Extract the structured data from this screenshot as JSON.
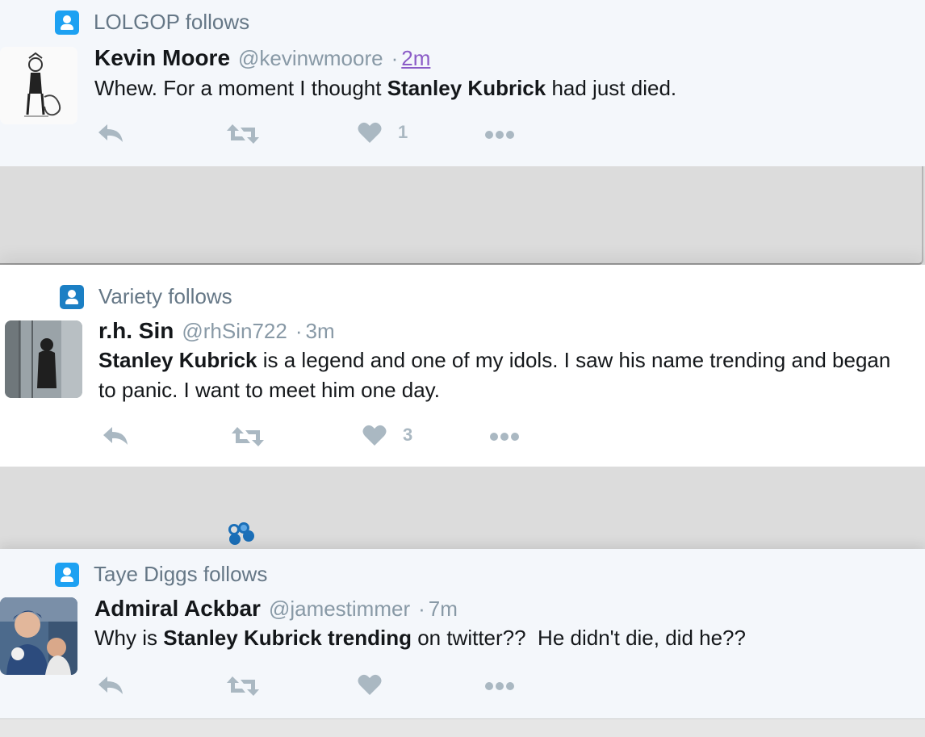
{
  "tweets": [
    {
      "context": "LOLGOP follows",
      "name": "Kevin Moore",
      "handle": "@kevinwmoore",
      "sep": "·",
      "time": "2m",
      "text_parts": [
        "Whew. For a moment I thought ",
        "Stanley Kubrick",
        " had just died."
      ],
      "likes": "1"
    },
    {
      "context": "Variety follows",
      "name": "r.h. Sin",
      "handle": "@rhSin722",
      "sep": "·",
      "time": "3m",
      "text_parts": [
        "Stanley Kubrick",
        " is a legend and one of my idols. I saw his name trending and began to panic. I want to meet him one day."
      ],
      "likes": "3"
    },
    {
      "context": "Taye Diggs follows",
      "name": "Admiral Ackbar",
      "handle": "@jamestimmer",
      "sep": "·",
      "time": "7m",
      "text_parts": [
        "Why is ",
        "Stanley Kubrick trending",
        " on twitter??  He didn't die, did he??"
      ],
      "likes": ""
    }
  ],
  "icons": {
    "context": "person-icon",
    "reply": "reply-icon",
    "retweet": "retweet-icon",
    "like": "heart-icon",
    "more": "more-icon",
    "loading": "loading-spinner-icon"
  },
  "colors": {
    "accent": "#1da1f2",
    "muted": "#657786",
    "action": "#aab8c2",
    "visited_link": "#8b5cc7"
  }
}
